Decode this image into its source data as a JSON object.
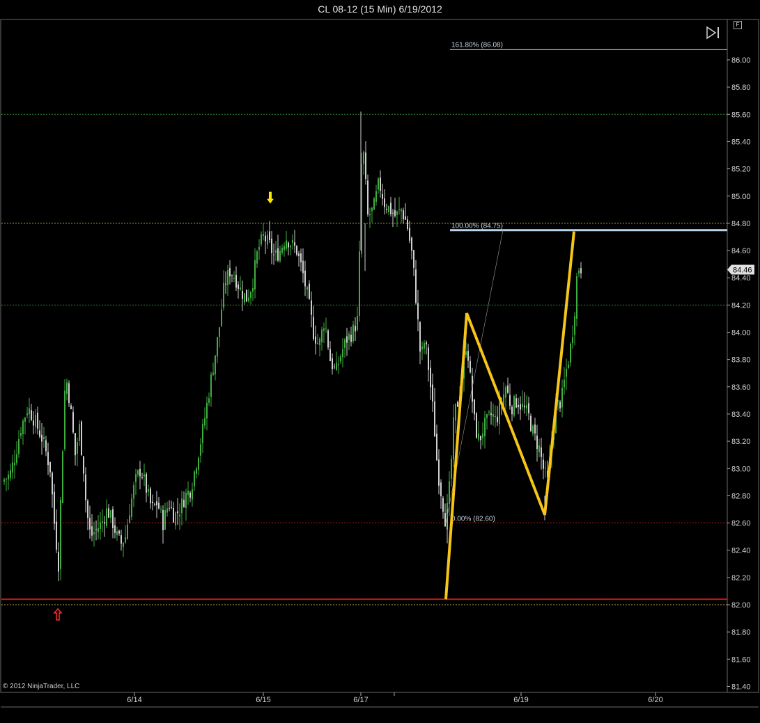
{
  "title": "CL 08-12 (15 Min)  6/19/2012",
  "copyright": "© 2012 NinjaTrader, LLC",
  "f_button": "F",
  "colors": {
    "up_candle": "#3fae3f",
    "down_candle": "#d0d0d0",
    "zigzag": "#f5c518",
    "fib_100": "#b9d3ea",
    "green_line": "#2e8b2e",
    "red_line": "#c01818",
    "yellow_dashed": "#b3a34a",
    "last_price_bg": "#e0e0e0"
  },
  "chart_data": {
    "type": "candlestick",
    "title": "CL 08-12 (15 Min)  6/19/2012",
    "ylim": [
      81.4,
      86.2
    ],
    "y_ticks": [
      "86.00",
      "85.80",
      "85.60",
      "85.40",
      "85.20",
      "85.00",
      "84.80",
      "84.60",
      "84.40",
      "84.20",
      "84.00",
      "83.80",
      "83.60",
      "83.40",
      "83.20",
      "83.00",
      "82.80",
      "82.60",
      "82.40",
      "82.20",
      "82.00",
      "81.80",
      "81.60",
      "81.40"
    ],
    "x_ticks": [
      "6/14",
      "6/15",
      "6/17",
      "6/19",
      "6/20"
    ],
    "last_price": "84.46",
    "horizontal_lines": [
      {
        "price": 85.6,
        "style": "dotted",
        "color": "green"
      },
      {
        "price": 84.8,
        "style": "dotted",
        "color": "yellow"
      },
      {
        "price": 84.2,
        "style": "dotted",
        "color": "green"
      },
      {
        "price": 82.6,
        "style": "dotted",
        "color": "red"
      },
      {
        "price": 82.04,
        "style": "solid",
        "color": "red"
      },
      {
        "price": 82.0,
        "style": "dotted",
        "color": "yellow"
      }
    ],
    "fib_labels": [
      {
        "label": "161.80% (86.08)",
        "price": 86.08
      },
      {
        "label": "100.00% (84.75)",
        "price": 84.75
      },
      {
        "label": "0.00% (82.60)",
        "price": 82.6
      }
    ],
    "zigzag": [
      {
        "x": "6/18",
        "price": 82.04
      },
      {
        "x": "6/18",
        "price": 84.14
      },
      {
        "x": "6/19",
        "price": 82.66
      },
      {
        "x": "6/19",
        "price": 84.74
      }
    ],
    "markers": [
      {
        "type": "down-arrow",
        "color": "yellow",
        "at": "6/15",
        "price": 84.98
      },
      {
        "type": "up-arrow",
        "color": "red",
        "at": "6/13",
        "price": 81.97
      }
    ],
    "close_path": [
      [
        0,
        82.9
      ],
      [
        14,
        82.95
      ],
      [
        22,
        83.1
      ],
      [
        30,
        83.3
      ],
      [
        40,
        83.45
      ],
      [
        50,
        83.35
      ],
      [
        62,
        83.2
      ],
      [
        72,
        83.0
      ],
      [
        78,
        82.6
      ],
      [
        84,
        82.3
      ],
      [
        88,
        82.9
      ],
      [
        94,
        83.7
      ],
      [
        100,
        83.5
      ],
      [
        108,
        83.1
      ],
      [
        114,
        83.3
      ],
      [
        120,
        83.0
      ],
      [
        124,
        82.7
      ],
      [
        130,
        82.5
      ],
      [
        138,
        82.55
      ],
      [
        146,
        82.6
      ],
      [
        154,
        82.7
      ],
      [
        162,
        82.6
      ],
      [
        168,
        82.5
      ],
      [
        174,
        82.45
      ],
      [
        180,
        82.5
      ],
      [
        186,
        82.7
      ],
      [
        194,
        82.9
      ],
      [
        202,
        83.0
      ],
      [
        210,
        82.85
      ],
      [
        218,
        82.7
      ],
      [
        226,
        82.75
      ],
      [
        234,
        82.6
      ],
      [
        242,
        82.75
      ],
      [
        250,
        82.65
      ],
      [
        258,
        82.7
      ],
      [
        266,
        82.8
      ],
      [
        274,
        82.85
      ],
      [
        282,
        83.05
      ],
      [
        290,
        83.25
      ],
      [
        298,
        83.5
      ],
      [
        306,
        83.75
      ],
      [
        314,
        84.0
      ],
      [
        322,
        84.35
      ],
      [
        330,
        84.45
      ],
      [
        338,
        84.4
      ],
      [
        346,
        84.3
      ],
      [
        354,
        84.25
      ],
      [
        362,
        84.35
      ],
      [
        370,
        84.6
      ],
      [
        378,
        84.7
      ],
      [
        386,
        84.65
      ],
      [
        394,
        84.55
      ],
      [
        402,
        84.6
      ],
      [
        410,
        84.7
      ],
      [
        418,
        84.65
      ],
      [
        426,
        84.6
      ],
      [
        434,
        84.45
      ],
      [
        442,
        84.25
      ],
      [
        450,
        84.0
      ],
      [
        458,
        83.9
      ],
      [
        466,
        84.1
      ],
      [
        474,
        83.8
      ],
      [
        482,
        83.7
      ],
      [
        490,
        83.85
      ],
      [
        498,
        83.95
      ],
      [
        506,
        84.0
      ],
      [
        514,
        84.1
      ],
      [
        520,
        85.45
      ],
      [
        528,
        84.85
      ],
      [
        536,
        84.9
      ],
      [
        544,
        85.1
      ],
      [
        552,
        84.95
      ],
      [
        560,
        84.9
      ],
      [
        568,
        84.85
      ],
      [
        576,
        84.9
      ],
      [
        584,
        84.8
      ],
      [
        592,
        84.55
      ],
      [
        598,
        84.2
      ],
      [
        604,
        83.8
      ],
      [
        610,
        83.95
      ],
      [
        616,
        83.7
      ],
      [
        622,
        83.4
      ],
      [
        628,
        83.0
      ],
      [
        634,
        82.8
      ],
      [
        640,
        82.6
      ],
      [
        646,
        82.9
      ],
      [
        652,
        83.4
      ],
      [
        658,
        83.5
      ],
      [
        664,
        83.7
      ],
      [
        670,
        83.95
      ],
      [
        676,
        83.6
      ],
      [
        682,
        83.3
      ],
      [
        688,
        83.2
      ],
      [
        694,
        83.3
      ],
      [
        700,
        83.35
      ],
      [
        706,
        83.4
      ],
      [
        712,
        83.35
      ],
      [
        718,
        83.45
      ],
      [
        726,
        83.6
      ],
      [
        734,
        83.45
      ],
      [
        742,
        83.5
      ],
      [
        750,
        83.45
      ],
      [
        758,
        83.4
      ],
      [
        766,
        83.25
      ],
      [
        774,
        83.15
      ],
      [
        780,
        83.0
      ],
      [
        786,
        82.9
      ],
      [
        792,
        83.2
      ],
      [
        798,
        83.45
      ],
      [
        806,
        83.5
      ],
      [
        812,
        83.7
      ],
      [
        818,
        83.85
      ],
      [
        824,
        84.1
      ],
      [
        828,
        84.4
      ],
      [
        832,
        84.5
      ],
      [
        836,
        84.45
      ]
    ]
  }
}
